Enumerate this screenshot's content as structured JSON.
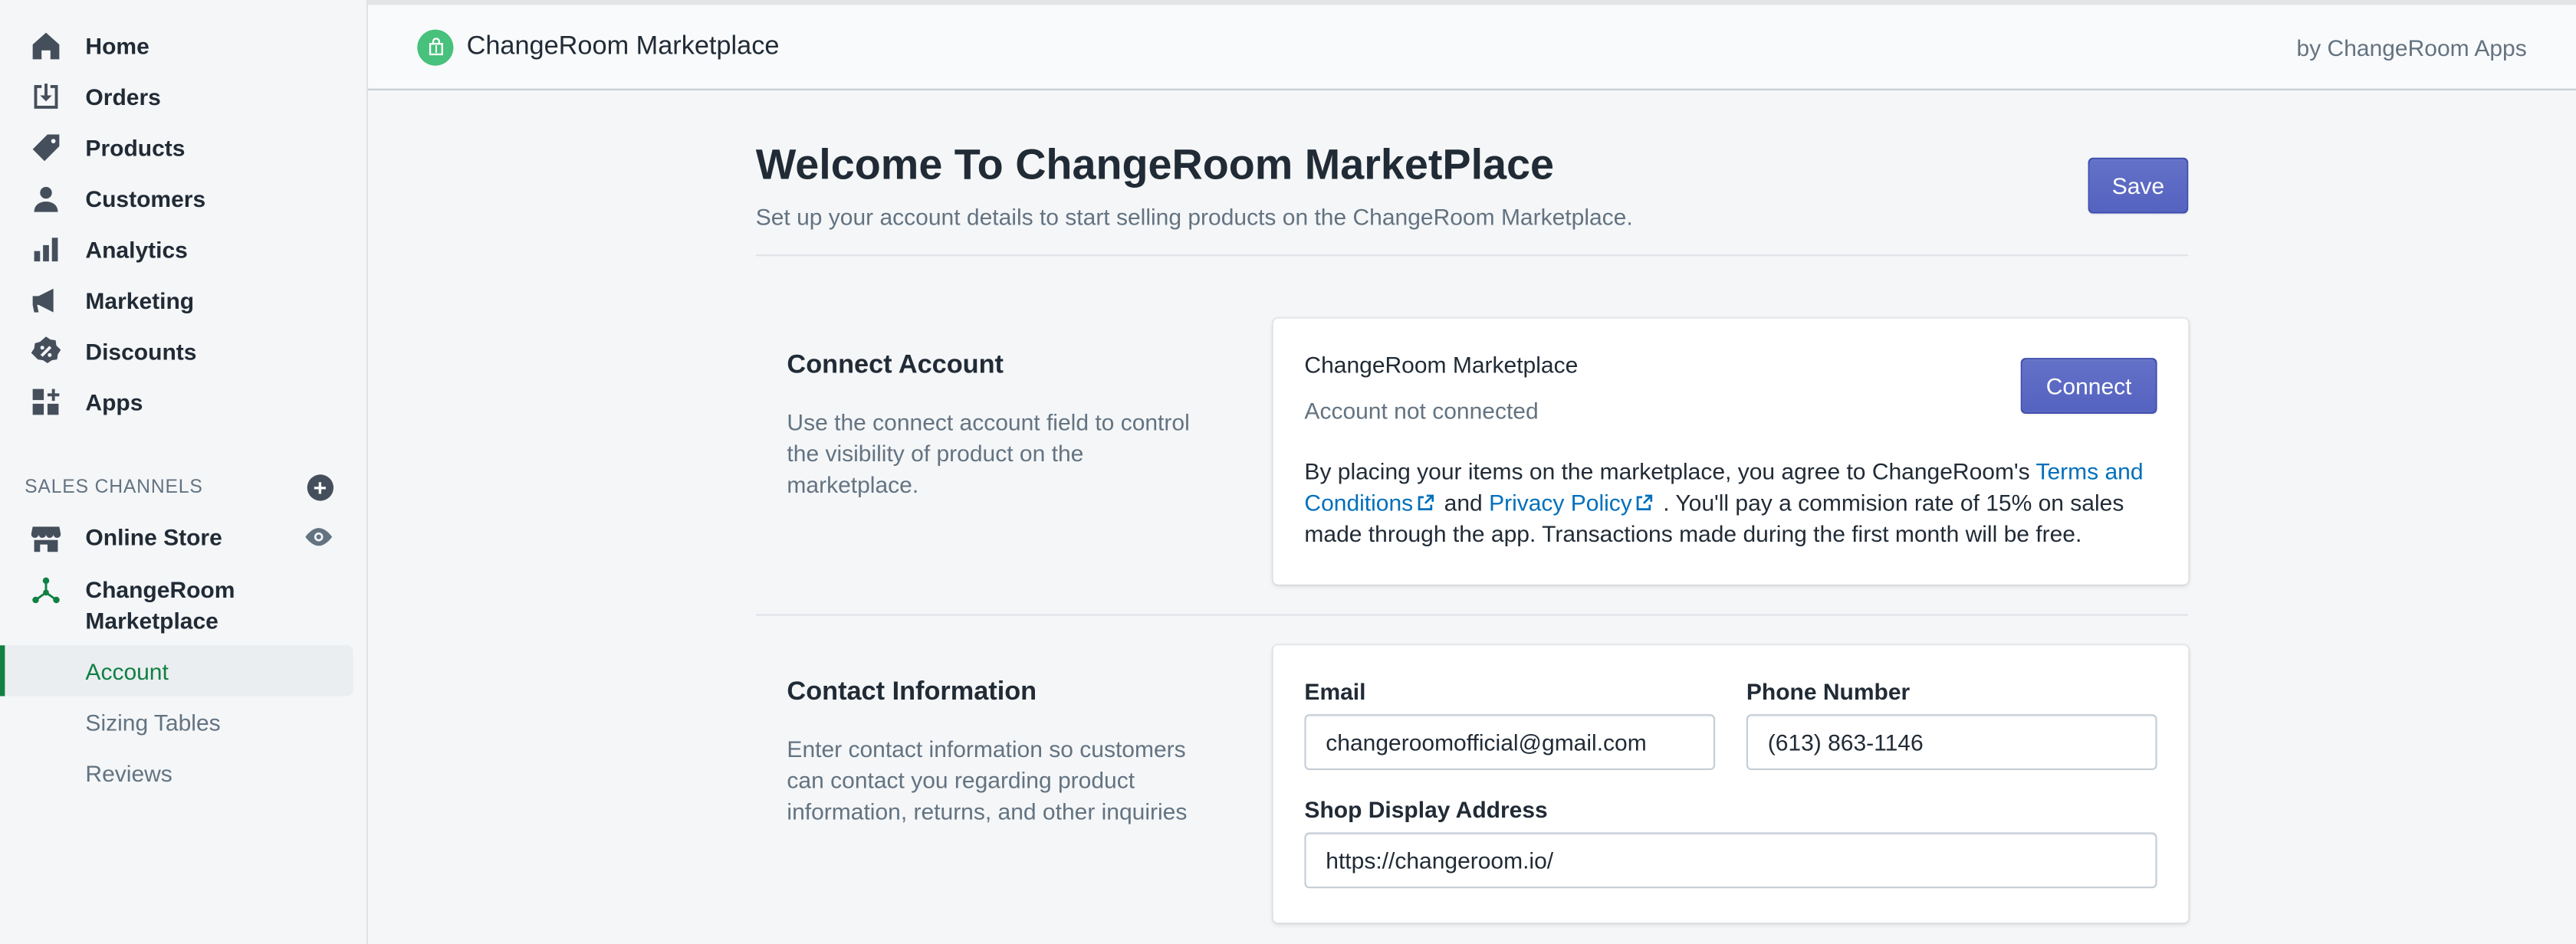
{
  "sidebar": {
    "items": [
      {
        "label": "Home",
        "icon": "home-icon"
      },
      {
        "label": "Orders",
        "icon": "orders-icon"
      },
      {
        "label": "Products",
        "icon": "tag-icon"
      },
      {
        "label": "Customers",
        "icon": "person-icon"
      },
      {
        "label": "Analytics",
        "icon": "bar-chart-icon"
      },
      {
        "label": "Marketing",
        "icon": "megaphone-icon"
      },
      {
        "label": "Discounts",
        "icon": "discount-icon"
      },
      {
        "label": "Apps",
        "icon": "apps-icon"
      }
    ],
    "sales_channels_label": "SALES CHANNELS",
    "channels": {
      "online_store": "Online Store",
      "marketplace": "ChangeRoom Marketplace"
    },
    "sub_items": [
      "Account",
      "Sizing Tables",
      "Reviews"
    ]
  },
  "topbar": {
    "app_name": "ChangeRoom Marketplace",
    "by": "by ChangeRoom Apps"
  },
  "page": {
    "title": "Welcome To ChangeRoom MarketPlace",
    "subtitle": "Set up your account details to start selling products on the ChangeRoom Marketplace.",
    "save_label": "Save"
  },
  "connect": {
    "title": "Connect Account",
    "description": "Use the connect account field to control the visibility of product on the marketplace.",
    "card_title": "ChangeRoom Marketplace",
    "status": "Account not connected",
    "button": "Connect",
    "body_prefix": "By placing your items on the marketplace, you agree to ChangeRoom's ",
    "terms_link": "Terms and Conditions",
    "and": " and ",
    "privacy_link": "Privacy Policy",
    "body_suffix": " . You'll pay a commision rate of 15% on sales made through the app. Transactions made during the first month will be free."
  },
  "contact": {
    "title": "Contact Information",
    "description": "Enter contact information so customers can contact you regarding product information, returns, and other inquiries",
    "email_label": "Email",
    "email_value": "changeroomofficial@gmail.com",
    "phone_label": "Phone Number",
    "phone_value": "(613) 863-1146",
    "address_label": "Shop Display Address",
    "address_value": "https://changeroom.io/"
  },
  "colors": {
    "accent": "#5c6ac4",
    "active_green": "#108043",
    "link": "#006fbb"
  }
}
